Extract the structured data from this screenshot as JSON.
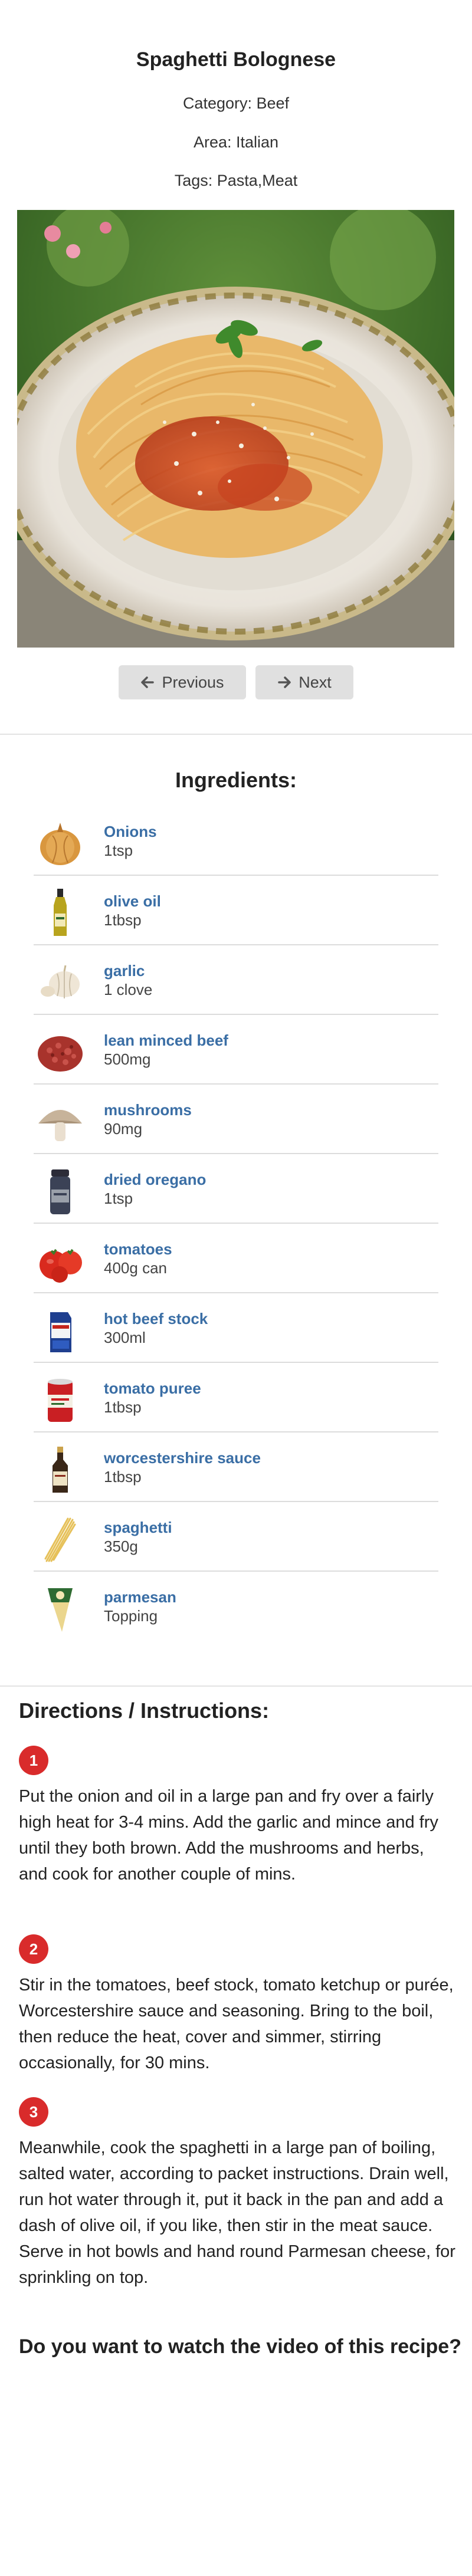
{
  "recipe": {
    "title": "Spaghetti Bolognese",
    "category": "Category: Beef",
    "area": "Area: Italian",
    "tags": "Tags: Pasta,Meat"
  },
  "nav": {
    "previous_label": "Previous",
    "next_label": "Next"
  },
  "ingredients": {
    "heading": "Ingredients:",
    "items": [
      {
        "name": "Onions",
        "measure": "1tsp",
        "icon": "onion-icon"
      },
      {
        "name": "olive oil",
        "measure": "1tbsp",
        "icon": "olive-oil-bottle-icon"
      },
      {
        "name": "garlic",
        "measure": "1 clove",
        "icon": "garlic-icon"
      },
      {
        "name": "lean minced beef",
        "measure": "500mg",
        "icon": "minced-beef-icon"
      },
      {
        "name": "mushrooms",
        "measure": "90mg",
        "icon": "mushroom-icon"
      },
      {
        "name": "dried oregano",
        "measure": "1tsp",
        "icon": "oregano-jar-icon"
      },
      {
        "name": "tomatoes",
        "measure": "400g can",
        "icon": "tomato-icon"
      },
      {
        "name": "hot beef stock",
        "measure": "300ml",
        "icon": "beef-stock-carton-icon"
      },
      {
        "name": "tomato puree",
        "measure": "1tbsp",
        "icon": "tomato-puree-can-icon"
      },
      {
        "name": "worcestershire sauce",
        "measure": "1tbsp",
        "icon": "sauce-bottle-icon"
      },
      {
        "name": "spaghetti",
        "measure": "350g",
        "icon": "spaghetti-icon"
      },
      {
        "name": "parmesan",
        "measure": "Topping",
        "icon": "parmesan-icon"
      }
    ]
  },
  "directions": {
    "heading": "Directions / Instructions:",
    "steps": [
      {
        "number": "1",
        "text": "Put the onion and oil in a large pan and fry over a fairly high heat for 3-4 mins. Add the garlic and mince and fry until they both brown. Add the mushrooms and herbs, and cook for another couple of mins."
      },
      {
        "number": "2",
        "text": "Stir in the tomatoes, beef stock, tomato ketchup or purée, Worcestershire sauce and seasoning. Bring to the boil, then reduce the heat, cover and simmer, stirring occasionally, for 30 mins."
      },
      {
        "number": "3",
        "text": "Meanwhile, cook the spaghetti in a large pan of boiling, salted water, according to packet instructions. Drain well, run hot water through it, put it back in the pan and add a dash of olive oil, if you like, then stir in the meat sauce. Serve in hot bowls and hand round Parmesan cheese, for sprinkling on top."
      }
    ]
  },
  "video": {
    "question": "Do you want to watch the video of this recipe?"
  },
  "colors": {
    "accent_link": "#3a6ea5",
    "step_badge": "#d92b2b",
    "button_bg": "#e0e0e0"
  }
}
